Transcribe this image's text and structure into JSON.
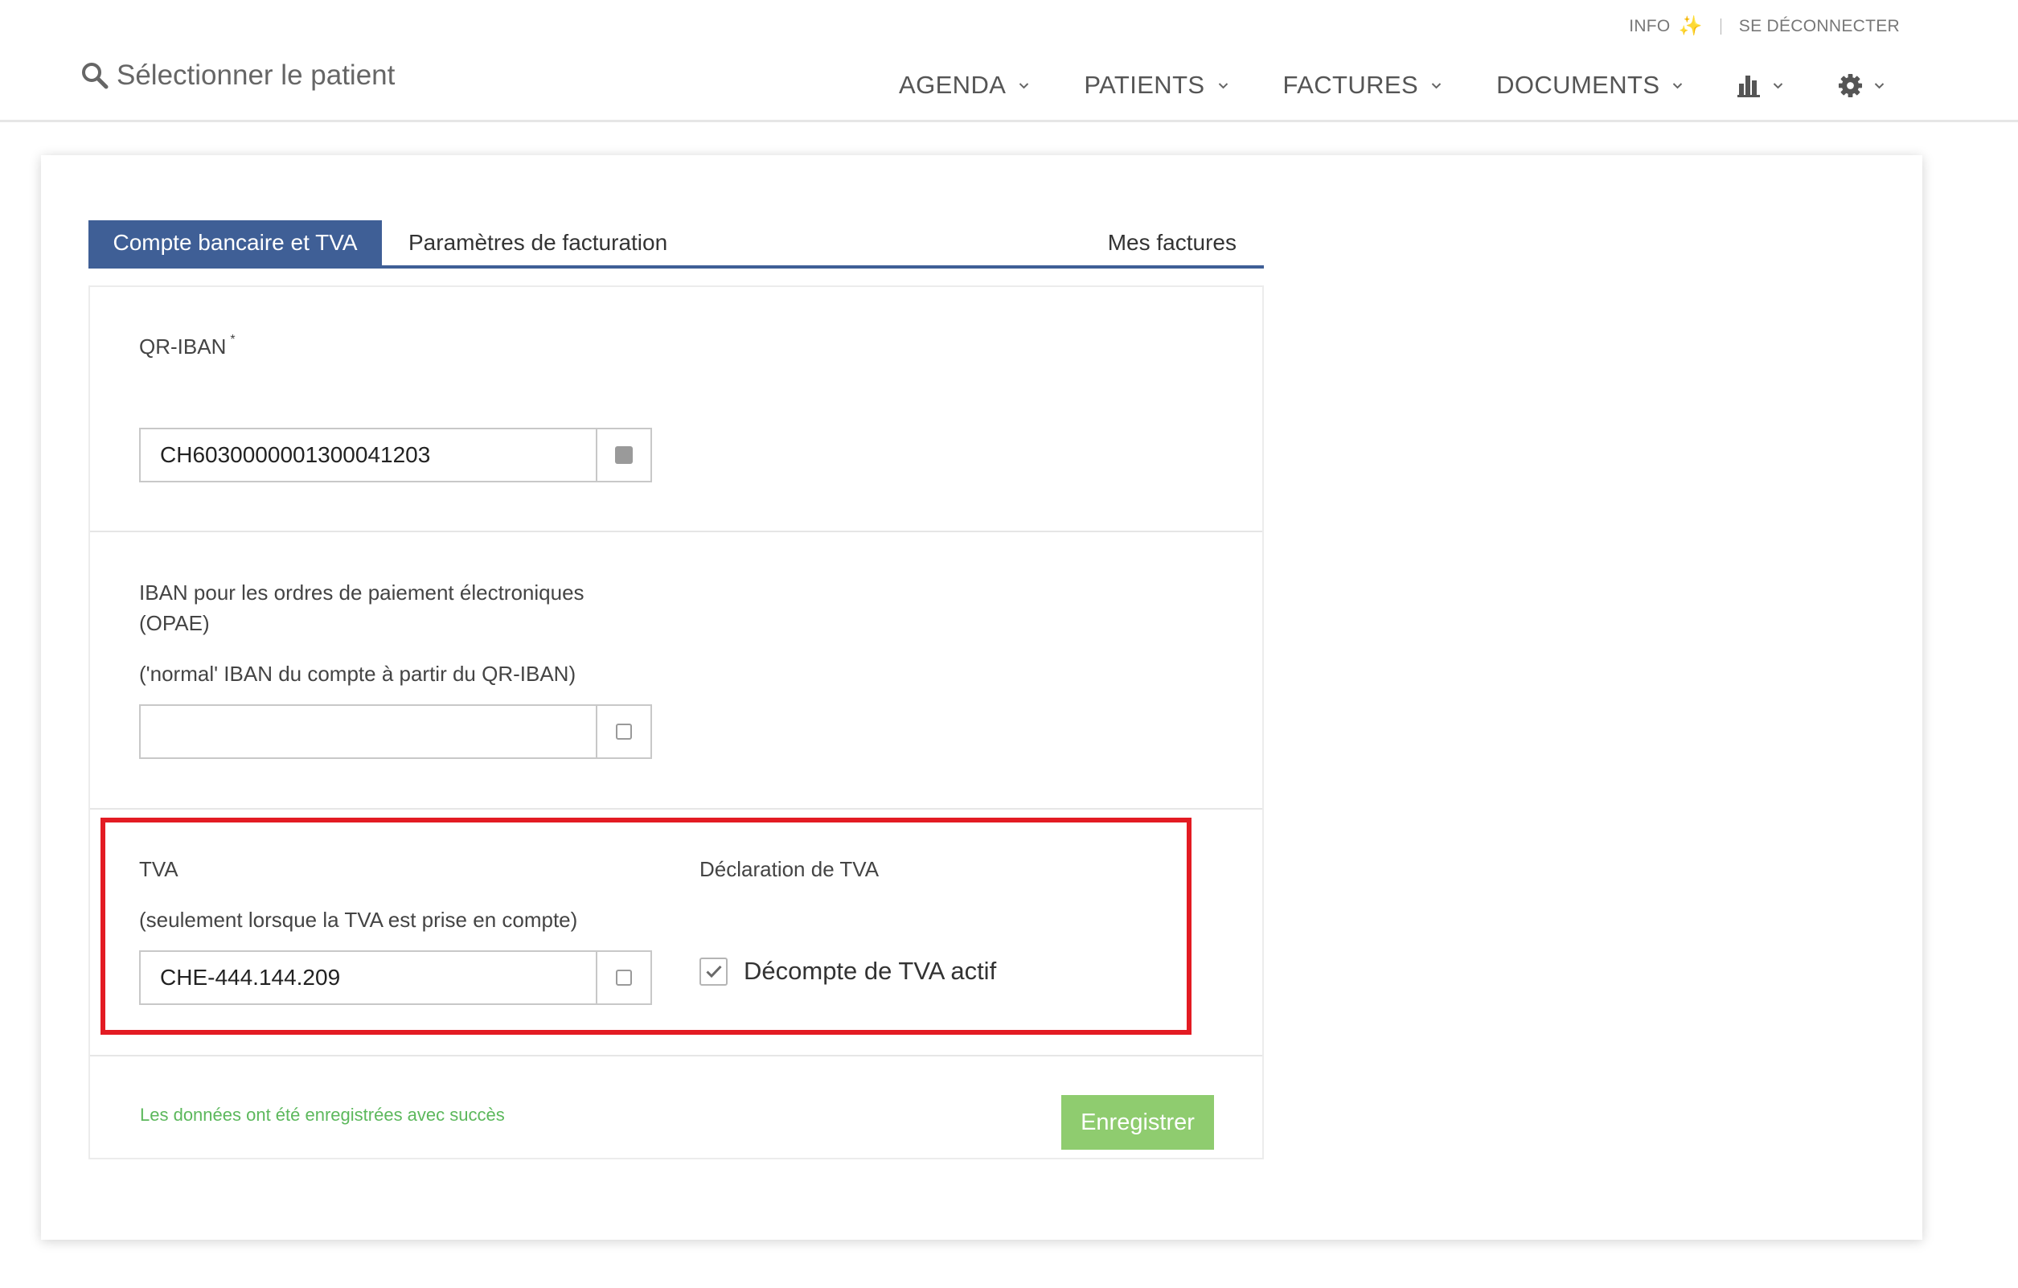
{
  "header": {
    "info_label": "INFO",
    "logout_label": "SE DÉCONNECTER",
    "patient_search_label": "Sélectionner le patient",
    "nav": [
      {
        "label": "AGENDA"
      },
      {
        "label": "PATIENTS"
      },
      {
        "label": "FACTURES"
      },
      {
        "label": "DOCUMENTS"
      }
    ],
    "icons": {
      "info": "sparkle-icon",
      "search": "search-icon",
      "stats": "bar-chart-icon",
      "settings": "gear-icon",
      "dropdown": "chevron-down-icon"
    }
  },
  "tabs": [
    {
      "label": "Compte bancaire et TVA",
      "active": true
    },
    {
      "label": "Paramètres de facturation",
      "active": false
    },
    {
      "label": "Mes factures",
      "active": false
    }
  ],
  "form": {
    "qr_iban": {
      "label": "QR-IBAN",
      "required_mark": "*",
      "value": "CH6030000001300041203"
    },
    "opae_iban": {
      "label_line1": "IBAN pour les ordres de paiement électroniques",
      "label_line2": "(OPAE)",
      "hint": "('normal' IBAN du compte à partir du QR-IBAN)",
      "value": ""
    },
    "tva": {
      "label": "TVA",
      "hint": "(seulement lorsque la TVA est prise en compte)",
      "value": "CHE-444.144.209"
    },
    "tva_declaration": {
      "label": "Déclaration de TVA",
      "checkbox_label": "Décompte de TVA actif",
      "checked": true
    }
  },
  "footer": {
    "success_message": "Les données ont été enregistrées avec succès",
    "save_label": "Enregistrer"
  },
  "colors": {
    "primary": "#3f5f96",
    "success_text": "#5cb85c",
    "save_button": "#8fcc6f",
    "highlight": "#e31b23"
  }
}
